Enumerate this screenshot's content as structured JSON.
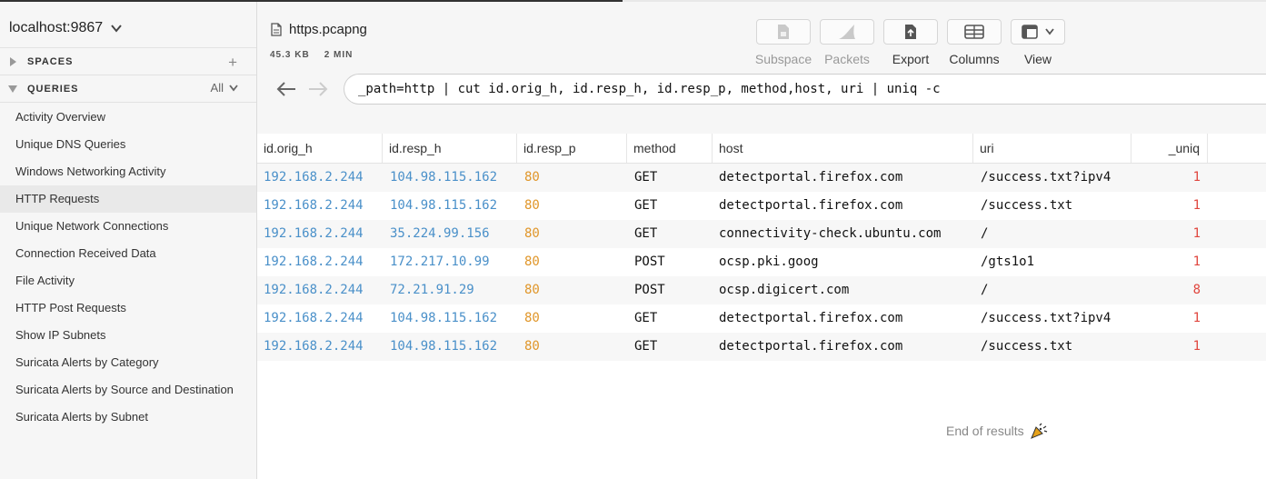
{
  "sidebar": {
    "host": "localhost:9867",
    "spaces_label": "SPACES",
    "queries_label": "QUERIES",
    "queries_filter": "All",
    "queries": [
      "Activity Overview",
      "Unique DNS Queries",
      "Windows Networking Activity",
      "HTTP Requests",
      "Unique Network Connections",
      "Connection Received Data",
      "File Activity",
      "HTTP Post Requests",
      "Show IP Subnets",
      "Suricata Alerts by Category",
      "Suricata Alerts by Source and Destination",
      "Suricata Alerts by Subnet"
    ],
    "active_query": "HTTP Requests"
  },
  "header": {
    "file_name": "https.pcapng",
    "file_size": "45.3 KB",
    "file_duration": "2 MIN",
    "toolbar": {
      "subspace": "Subspace",
      "packets": "Packets",
      "export": "Export",
      "columns": "Columns",
      "view": "View"
    },
    "query": "_path=http | cut id.orig_h, id.resp_h, id.resp_p, method,host, uri | uniq -c"
  },
  "table": {
    "columns": [
      "id.orig_h",
      "id.resp_h",
      "id.resp_p",
      "method",
      "host",
      "uri",
      "_uniq"
    ],
    "rows": [
      [
        "192.168.2.244",
        "104.98.115.162",
        "80",
        "GET",
        "detectportal.firefox.com",
        "/success.txt?ipv4",
        "1"
      ],
      [
        "192.168.2.244",
        "104.98.115.162",
        "80",
        "GET",
        "detectportal.firefox.com",
        "/success.txt",
        "1"
      ],
      [
        "192.168.2.244",
        "35.224.99.156",
        "80",
        "GET",
        "connectivity-check.ubuntu.com",
        "/",
        "1"
      ],
      [
        "192.168.2.244",
        "172.217.10.99",
        "80",
        "POST",
        "ocsp.pki.goog",
        "/gts1o1",
        "1"
      ],
      [
        "192.168.2.244",
        "72.21.91.29",
        "80",
        "POST",
        "ocsp.digicert.com",
        "/",
        "8"
      ],
      [
        "192.168.2.244",
        "104.98.115.162",
        "80",
        "GET",
        "detectportal.firefox.com",
        "/success.txt?ipv4",
        "1"
      ],
      [
        "192.168.2.244",
        "104.98.115.162",
        "80",
        "GET",
        "detectportal.firefox.com",
        "/success.txt",
        "1"
      ]
    ]
  },
  "end_message": "End of results",
  "colors": {
    "ip": "#4a90c9",
    "port": "#e0962a",
    "count": "#e0463e"
  }
}
